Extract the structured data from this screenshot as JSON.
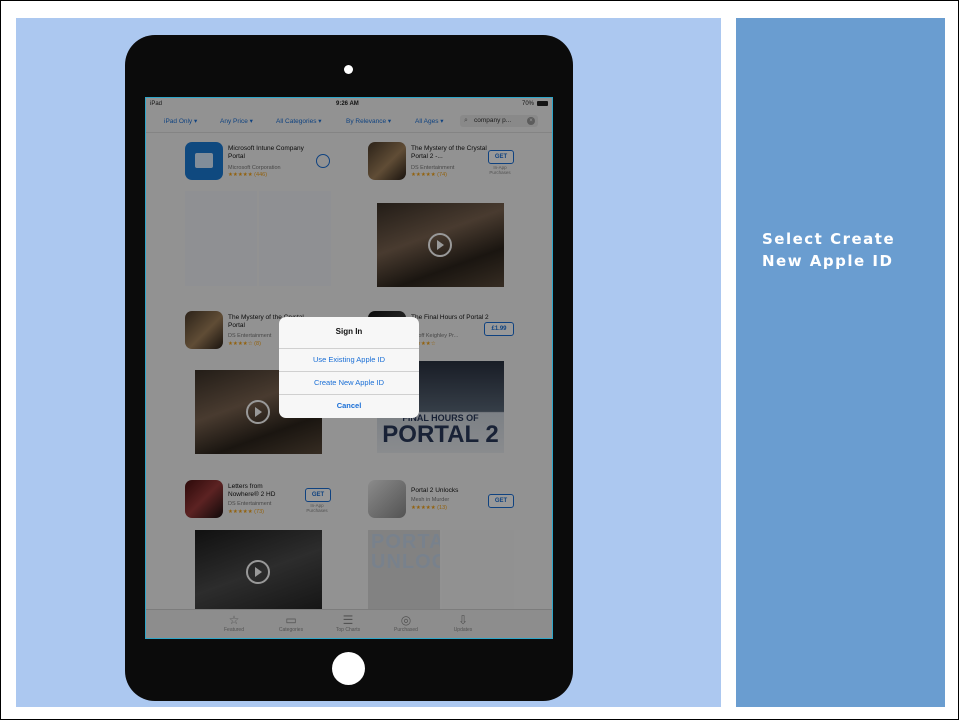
{
  "slide": {
    "caption": "Select Create New Apple ID"
  },
  "status_bar": {
    "device": "iPad",
    "time": "9:26 AM",
    "battery": "70%"
  },
  "filters": {
    "device_filter": "iPad Only ▾",
    "price_filter": "Any Price ▾",
    "category_filter": "All Categories ▾",
    "sort_filter": "By Relevance ▾",
    "age_filter": "All Ages ▾"
  },
  "search": {
    "query": "company p..."
  },
  "apps": [
    {
      "name": "Microsoft Intune Company Portal",
      "developer": "Microsoft Corporation",
      "rating": "★★★★★ (446)"
    },
    {
      "name": "The Mystery of the Crystal Portal 2 -...",
      "developer": "DS Entertainment",
      "rating": "★★★★★ (74)",
      "button": "GET",
      "note": "In-App Purchases"
    },
    {
      "name": "The Mystery of the Crystal Portal",
      "developer": "DS Entertainment",
      "rating": "★★★★☆ (8)"
    },
    {
      "name": "The Final Hours of Portal 2",
      "developer": "Geoff Keighley Pr...",
      "rating": "★★★★☆",
      "button": "£1.99"
    },
    {
      "name": "Letters from Nowhere® 2 HD",
      "developer": "DS Entertainment",
      "rating": "★★★★★ (73)",
      "button": "GET",
      "note": "In-App Purchases"
    },
    {
      "name": "Portal 2 Unlocks",
      "developer": "Mesh in Murder",
      "rating": "★★★★★ (13)",
      "button": "GET"
    }
  ],
  "screenshots": {
    "portal_title_small": "FINAL HOURS OF",
    "portal_title_big": "PORTAL 2",
    "unlocks_word": "PORTAL 2 UNLOCKS"
  },
  "dialog": {
    "title": "Sign In",
    "use_existing": "Use Existing Apple ID",
    "create_new": "Create New Apple ID",
    "cancel": "Cancel"
  },
  "tab_bar": [
    {
      "label": "Featured",
      "icon": "star-icon"
    },
    {
      "label": "Categories",
      "icon": "categories-icon"
    },
    {
      "label": "Top Charts",
      "icon": "top-charts-icon"
    },
    {
      "label": "Purchased",
      "icon": "purchased-icon"
    },
    {
      "label": "Updates",
      "icon": "updates-icon"
    }
  ],
  "colors": {
    "accent": "#1a6fd6",
    "slide_left": "#acc8f0",
    "slide_right": "#6a9dd0",
    "rating": "#f3a31a"
  }
}
